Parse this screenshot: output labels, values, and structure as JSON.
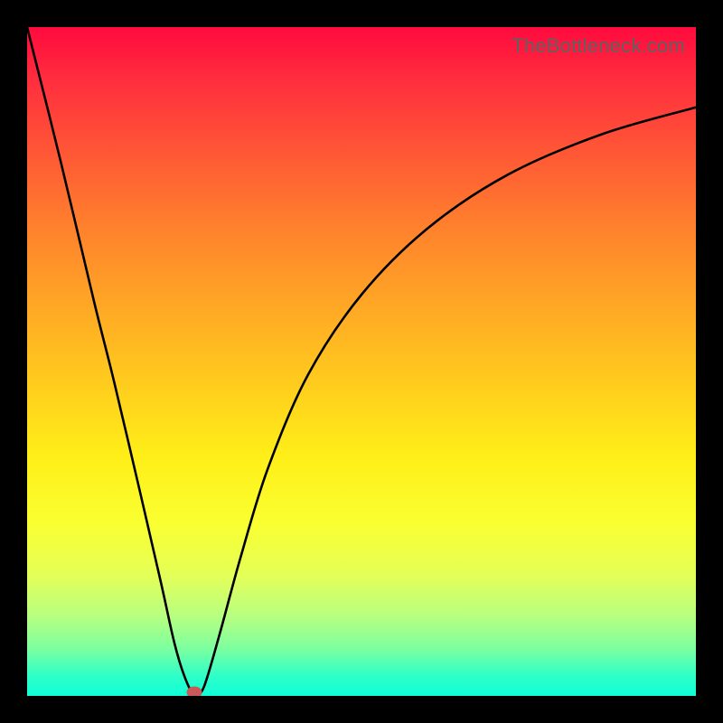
{
  "watermark": "TheBottleneck.com",
  "chart_data": {
    "type": "line",
    "title": "",
    "xlabel": "",
    "ylabel": "",
    "xlim": [
      0,
      100
    ],
    "ylim": [
      0,
      100
    ],
    "series": [
      {
        "name": "bottleneck-curve",
        "x": [
          0,
          5,
          10,
          13,
          17,
          20,
          22,
          23.5,
          25,
          26,
          27,
          29,
          32,
          36,
          42,
          50,
          60,
          72,
          86,
          100
        ],
        "values": [
          100,
          80,
          59,
          47,
          30,
          17,
          8,
          3,
          0,
          0.5,
          3,
          10,
          21,
          34,
          48,
          60,
          70,
          78,
          84,
          88
        ]
      }
    ],
    "marker": {
      "x": 25,
      "y": 0
    }
  },
  "colors": {
    "curve": "#000000",
    "marker": "#c85a5a",
    "frame": "#000000"
  }
}
